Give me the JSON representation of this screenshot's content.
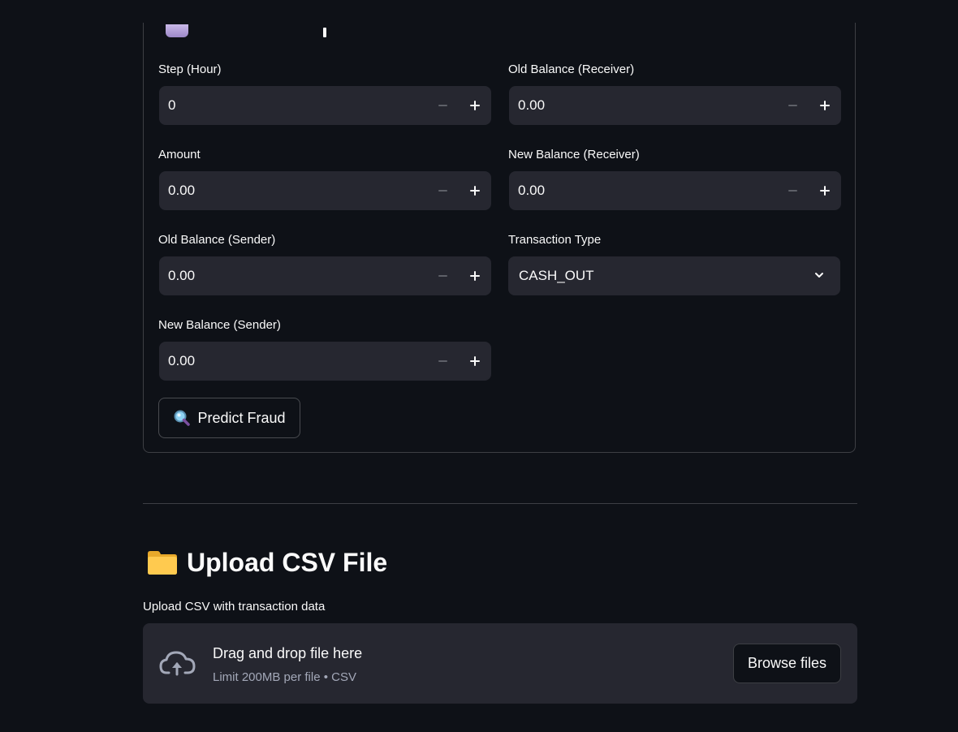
{
  "form": {
    "fields": {
      "step": {
        "label": "Step (Hour)",
        "value": "0"
      },
      "amount": {
        "label": "Amount",
        "value": "0.00"
      },
      "old_balance_sender": {
        "label": "Old Balance (Sender)",
        "value": "0.00"
      },
      "new_balance_sender": {
        "label": "New Balance (Sender)",
        "value": "0.00"
      },
      "old_balance_receiver": {
        "label": "Old Balance (Receiver)",
        "value": "0.00"
      },
      "new_balance_receiver": {
        "label": "New Balance (Receiver)",
        "value": "0.00"
      }
    },
    "transaction_type": {
      "label": "Transaction Type",
      "selected": "CASH_OUT"
    },
    "predict_button": {
      "label": "Predict Fraud",
      "icon": "magnifier-icon"
    }
  },
  "upload": {
    "title": "Upload CSV File",
    "title_icon": "folder-icon",
    "label": "Upload CSV with transaction data",
    "dropzone": {
      "title": "Drag and drop file here",
      "subtitle": "Limit 200MB per file • CSV",
      "icon": "cloud-upload-icon"
    },
    "browse_button": "Browse files"
  },
  "colors": {
    "background": "#0e1117",
    "input_bg": "#262730",
    "text": "#fafafa",
    "muted_text": "#a3a8b8"
  }
}
